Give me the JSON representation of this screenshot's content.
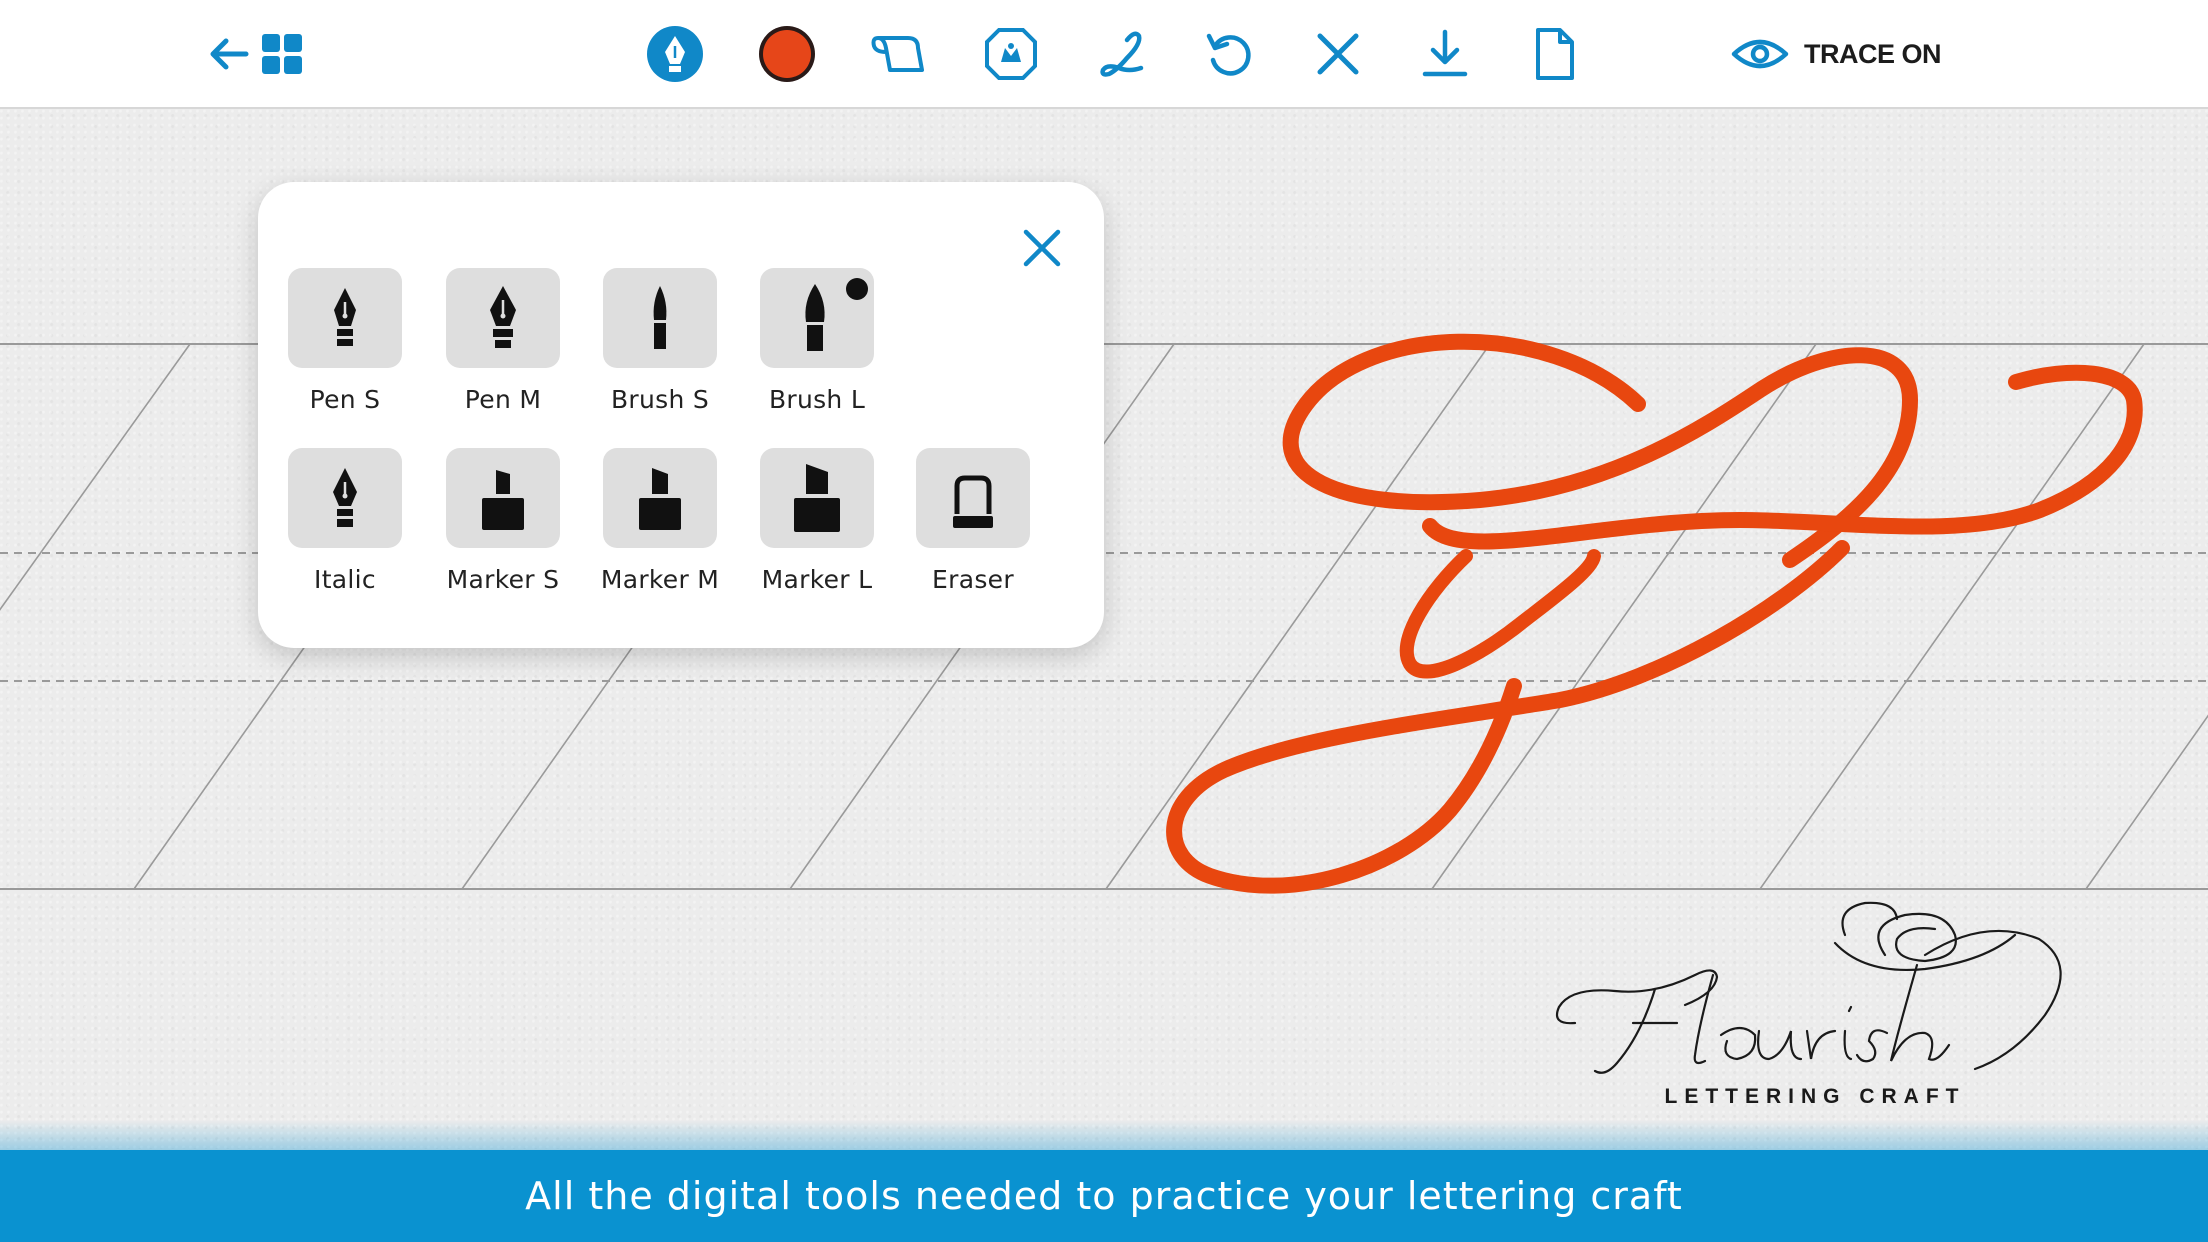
{
  "toolbar": {
    "buttons": [
      {
        "name": "back-arrow-icon",
        "label": "Back"
      },
      {
        "name": "grid-menu-icon",
        "label": "Menu"
      },
      {
        "name": "pen-nib-icon",
        "label": "Brush"
      },
      {
        "name": "color-swatch-icon",
        "label": "Color"
      },
      {
        "name": "paper-scroll-icon",
        "label": "Paper"
      },
      {
        "name": "stamp-badge-icon",
        "label": "Stamp"
      },
      {
        "name": "lettering-guide-icon",
        "label": "Guide"
      },
      {
        "name": "undo-icon",
        "label": "Undo"
      },
      {
        "name": "clear-icon",
        "label": "Clear"
      },
      {
        "name": "download-icon",
        "label": "Download"
      },
      {
        "name": "new-page-icon",
        "label": "New page"
      }
    ],
    "trace_label": "TRACE ON",
    "accent_color": "#1088c8",
    "current_color": "#e64619"
  },
  "brush_panel": {
    "tools": [
      {
        "label": "Pen S",
        "icon": "pen-nib-small-icon",
        "selected": false
      },
      {
        "label": "Pen M",
        "icon": "pen-nib-medium-icon",
        "selected": false
      },
      {
        "label": "Brush S",
        "icon": "brush-small-icon",
        "selected": false
      },
      {
        "label": "Brush L",
        "icon": "brush-large-icon",
        "selected": true
      },
      {
        "label": "Italic",
        "icon": "italic-nib-icon",
        "selected": false
      },
      {
        "label": "Marker S",
        "icon": "marker-small-icon",
        "selected": false
      },
      {
        "label": "Marker M",
        "icon": "marker-medium-icon",
        "selected": false
      },
      {
        "label": "Marker L",
        "icon": "marker-large-icon",
        "selected": false
      },
      {
        "label": "Eraser",
        "icon": "eraser-icon",
        "selected": false
      }
    ]
  },
  "stroke_color": "#e8470f",
  "logo": {
    "title": "Flourish",
    "subtitle": "LETTERING CRAFT"
  },
  "banner": {
    "text": "All the digital tools needed to practice your lettering craft"
  }
}
